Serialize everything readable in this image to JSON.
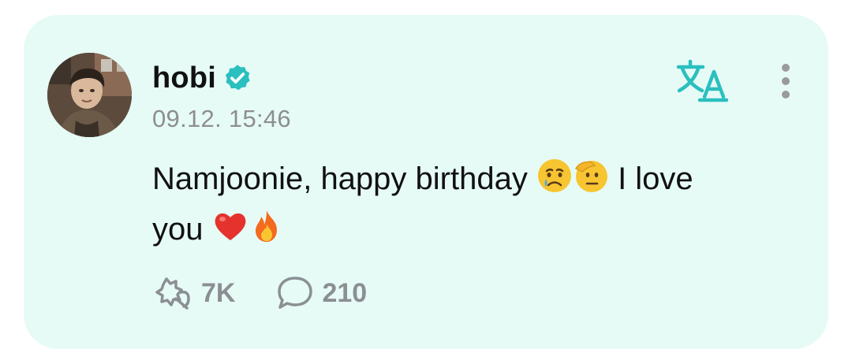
{
  "post": {
    "author": {
      "name": "hobi",
      "verified": true,
      "avatar_icon": "profile-photo"
    },
    "timestamp": "09.12. 15:46",
    "text_part_1": "Namjoonie, happy birthday ",
    "text_part_2": " I love",
    "text_part_3": "you ",
    "emojis": [
      "crying-face",
      "saluting-face",
      "red-heart",
      "fire"
    ],
    "likes_count": "7K",
    "comments_count": "210"
  },
  "icons": {
    "translate": "translate-icon",
    "more": "more-vertical-icon",
    "like": "like-icon",
    "comment": "comment-icon",
    "verified": "verified-badge-icon"
  },
  "colors": {
    "card_background": "#e6fbf6",
    "accent_teal": "#2bbfbf",
    "text_primary": "#111111",
    "text_secondary": "#8e8e8e",
    "action_gray": "#8b8f93"
  }
}
